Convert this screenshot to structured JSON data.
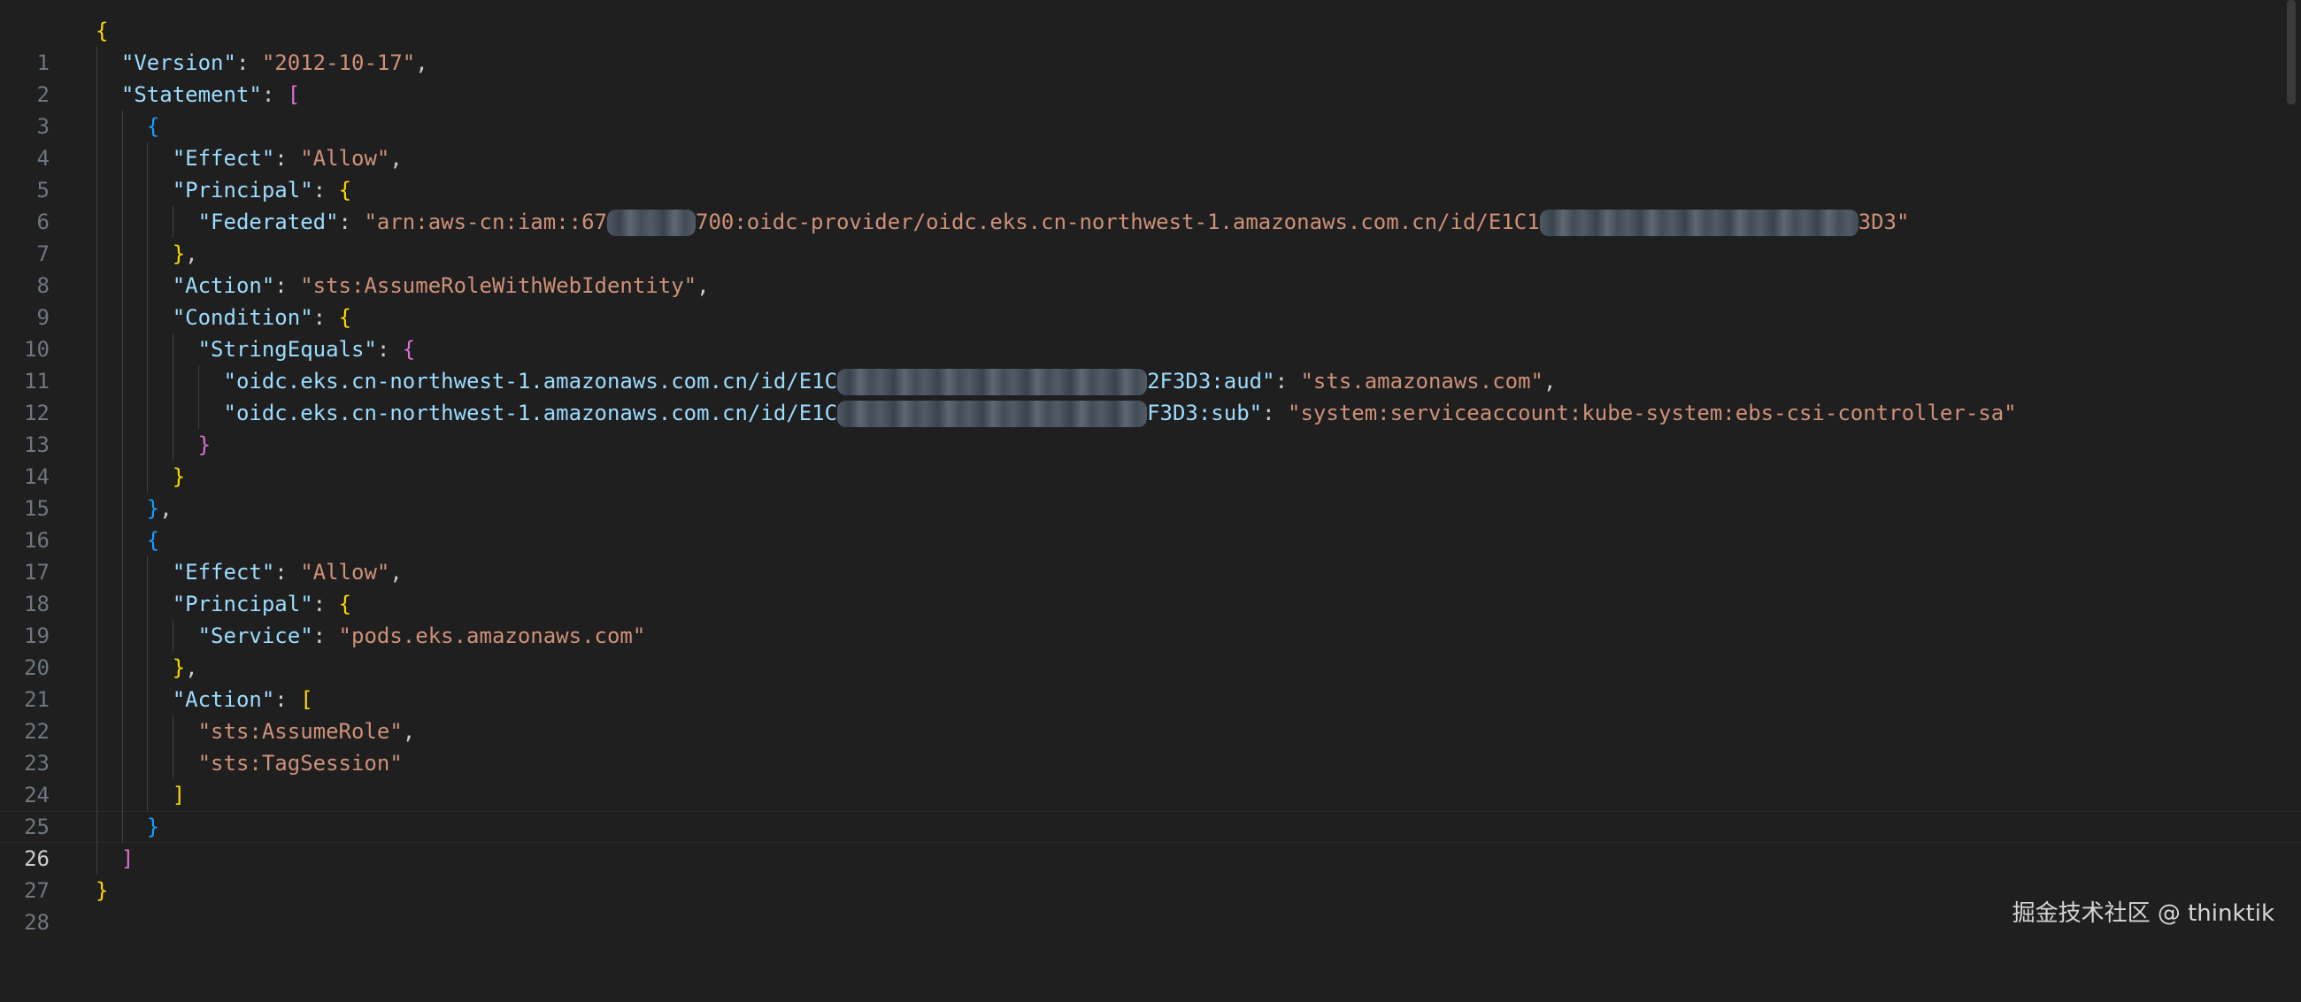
{
  "editor": {
    "line_numbers": [
      "1",
      "2",
      "3",
      "4",
      "5",
      "6",
      "7",
      "8",
      "9",
      "10",
      "11",
      "12",
      "13",
      "14",
      "15",
      "16",
      "17",
      "18",
      "19",
      "20",
      "21",
      "22",
      "23",
      "24",
      "25",
      "26",
      "27",
      "28"
    ],
    "current_line": "26",
    "tokens": {
      "l1_open": "{",
      "version_key": "\"Version\"",
      "version_val": "\"2012-10-17\"",
      "statement_key": "\"Statement\"",
      "statement_open": "[",
      "s1_open": "{",
      "s1_effect_key": "\"Effect\"",
      "s1_effect_val": "\"Allow\"",
      "s1_principal_key": "\"Principal\"",
      "s1_principal_open": "{",
      "federated_key": "\"Federated\"",
      "federated_val_a": "\"arn:aws-cn:iam::67",
      "federated_val_b": "700:oidc-provider/oidc.eks.cn-northwest-1.amazonaws.com.cn/id/E1C1",
      "federated_val_c": "3D3\"",
      "s1_principal_close": "}",
      "s1_action_key": "\"Action\"",
      "s1_action_val": "\"sts:AssumeRoleWithWebIdentity\"",
      "condition_key": "\"Condition\"",
      "condition_open": "{",
      "stringequals_key": "\"StringEquals\"",
      "stringequals_open": "{",
      "aud_key_a": "\"oidc.eks.cn-northwest-1.amazonaws.com.cn/id/E1C",
      "aud_key_b": "2F3D3:aud\"",
      "aud_val": "\"sts.amazonaws.com\"",
      "sub_key_a": "\"oidc.eks.cn-northwest-1.amazonaws.com.cn/id/E1C",
      "sub_key_b": "F3D3:sub\"",
      "sub_val": "\"system:serviceaccount:kube-system:ebs-csi-controller-sa\"",
      "stringequals_close": "}",
      "condition_close": "}",
      "s1_close": "}",
      "s2_open": "{",
      "s2_effect_key": "\"Effect\"",
      "s2_effect_val": "\"Allow\"",
      "s2_principal_key": "\"Principal\"",
      "s2_principal_open": "{",
      "service_key": "\"Service\"",
      "service_val": "\"pods.eks.amazonaws.com\"",
      "s2_principal_close": "}",
      "s2_action_key": "\"Action\"",
      "s2_action_open": "[",
      "assume_role": "\"sts:AssumeRole\"",
      "tag_session": "\"sts:TagSession\"",
      "s2_action_close": "]",
      "s2_close": "}",
      "statement_close": "]",
      "l28_close": "}",
      "colon": ": ",
      "comma": ","
    }
  },
  "watermark": "掘金技术社区 @ thinktik",
  "colors": {
    "background": "#1f1f1f",
    "key": "#9cdcfe",
    "string": "#ce9178",
    "bracket_level1": "#ffd700",
    "bracket_level2": "#da70d6",
    "bracket_level3": "#179fff",
    "line_number": "#6e7681"
  }
}
